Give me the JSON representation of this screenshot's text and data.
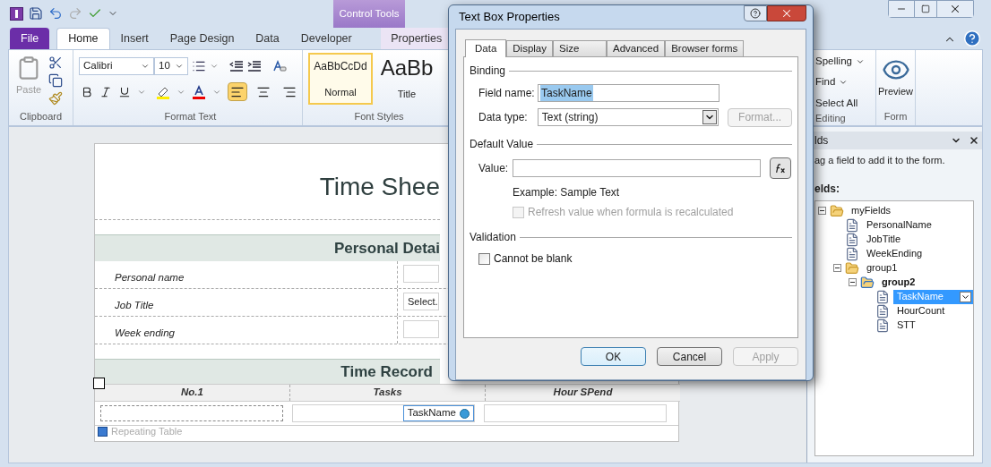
{
  "contextual_tab_group": "Control Tools",
  "ribbon_tabs": [
    {
      "label": "File",
      "kind": "file",
      "selected": false
    },
    {
      "label": "Home",
      "kind": "tab",
      "selected": true
    },
    {
      "label": "Insert",
      "kind": "tab",
      "selected": false
    },
    {
      "label": "Page Design",
      "kind": "tab",
      "selected": false
    },
    {
      "label": "Data",
      "kind": "tab",
      "selected": false
    },
    {
      "label": "Developer",
      "kind": "tab",
      "selected": false
    },
    {
      "label": "Properties",
      "kind": "contextual",
      "selected": false
    }
  ],
  "clipboard": {
    "paste": "Paste",
    "label": "Clipboard"
  },
  "format_text": {
    "font": "Calibri",
    "size": "10",
    "label": "Format Text",
    "alignment": [
      {
        "selected": true
      },
      {
        "selected": false
      },
      {
        "selected": false
      }
    ]
  },
  "font_styles": {
    "label": "Font Styles",
    "styles": [
      {
        "preview": "AaBbCcDd",
        "name": "Normal",
        "selected": true
      },
      {
        "preview": "AaBb",
        "name": "Title",
        "selected": false
      }
    ]
  },
  "editing": {
    "items": [
      "Spelling",
      "Find",
      "Select All"
    ],
    "label": "Editing"
  },
  "form_group": {
    "preview": "Preview",
    "label": "Form"
  },
  "form": {
    "title": "Time Shee",
    "section": "Personal Detai",
    "fields": [
      {
        "label": "Personal name"
      },
      {
        "label": "Job Title",
        "value": "Select."
      },
      {
        "label": "Week ending"
      }
    ],
    "section_2": "Time Record",
    "columns": [
      "No.1",
      "Tasks",
      "Hour SPend"
    ],
    "selected_control": "TaskName",
    "footer": "Repeating Table"
  },
  "fields_pane": {
    "title": "lds",
    "hint": "ag a field to add it to the form.",
    "label": "elds:",
    "tree": [
      {
        "name": "myFields",
        "kind": "folder",
        "expanded": true,
        "selected": false,
        "children": [
          {
            "name": "PersonalName",
            "kind": "field",
            "selected": false
          },
          {
            "name": "JobTitle",
            "kind": "field",
            "selected": false
          },
          {
            "name": "WeekEnding",
            "kind": "field",
            "selected": false
          },
          {
            "name": "group1",
            "kind": "folder",
            "expanded": true,
            "selected": false,
            "children": [
              {
                "name": "group2",
                "kind": "repeating",
                "expanded": true,
                "selected": false,
                "children": [
                  {
                    "name": "TaskName",
                    "kind": "field",
                    "selected": true
                  },
                  {
                    "name": "HourCount",
                    "kind": "field",
                    "selected": false
                  },
                  {
                    "name": "STT",
                    "kind": "field",
                    "selected": false
                  }
                ]
              }
            ]
          }
        ]
      }
    ]
  },
  "dialog": {
    "title": "Text Box Properties",
    "tabs": [
      {
        "label": "Data",
        "selected": true
      },
      {
        "label": "Display",
        "selected": false
      },
      {
        "label": "Size",
        "selected": false
      },
      {
        "label": "Advanced",
        "selected": false
      },
      {
        "label": "Browser forms",
        "selected": false
      }
    ],
    "binding": "Binding",
    "field_name_label": "Field name:",
    "field_name": "TaskName",
    "data_type_label": "Data type:",
    "data_type": "Text (string)",
    "format_button": {
      "label": "Format...",
      "disabled": true
    },
    "default_value": "Default Value",
    "value_label": "Value:",
    "example": "Example: Sample Text",
    "refresh": {
      "label": "Refresh value when formula is recalculated",
      "checked": false,
      "disabled": true
    },
    "validation": "Validation",
    "cannot_be_blank": {
      "label": "Cannot be blank",
      "checked": false,
      "disabled": false
    },
    "buttons": [
      {
        "label": "OK",
        "disabled": false
      },
      {
        "label": "Cancel",
        "disabled": false
      },
      {
        "label": "Apply",
        "disabled": true
      }
    ]
  }
}
